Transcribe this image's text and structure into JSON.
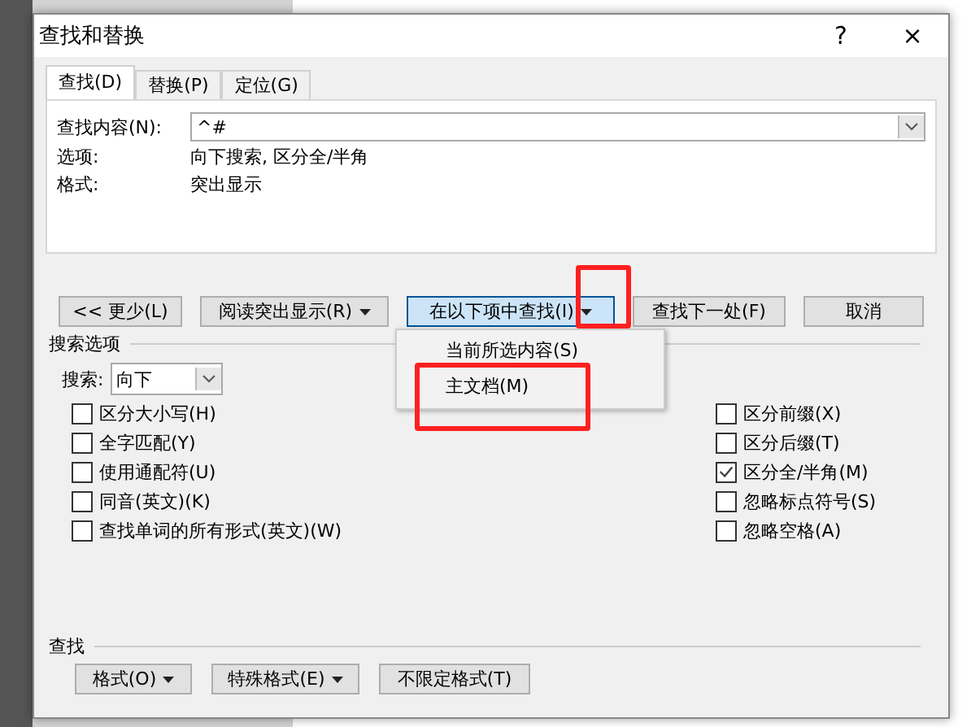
{
  "window": {
    "title": "查找和替换",
    "help": "?",
    "close": "×"
  },
  "tabs": [
    {
      "label": "查找(D)",
      "selected": true
    },
    {
      "label": "替换(P)",
      "selected": false
    },
    {
      "label": "定位(G)",
      "selected": false
    }
  ],
  "find": {
    "label": "查找内容(N):",
    "value": "^#"
  },
  "info": [
    {
      "label": "选项:",
      "value": "向下搜索, 区分全/半角"
    },
    {
      "label": "格式:",
      "value": "突出显示"
    }
  ],
  "buttons": [
    {
      "label": "<< 更少(L)",
      "dropdown": false,
      "pressed": false
    },
    {
      "label": "阅读突出显示(R)",
      "dropdown": true,
      "pressed": false
    },
    {
      "label": "在以下项中查找(I)",
      "dropdown": true,
      "pressed": true
    },
    {
      "label": "查找下一处(F)",
      "dropdown": false,
      "pressed": false
    },
    {
      "label": "取消",
      "dropdown": false,
      "pressed": false
    }
  ],
  "menu": {
    "items": [
      {
        "label": "当前所选内容(S)"
      },
      {
        "label": "主文档(M)"
      }
    ]
  },
  "search_options": {
    "title": "搜索选项",
    "direction_label": "搜索:",
    "direction": "向下",
    "left": [
      {
        "label": "区分大小写(H)",
        "checked": false
      },
      {
        "label": "全字匹配(Y)",
        "checked": false
      },
      {
        "label": "使用通配符(U)",
        "checked": false
      },
      {
        "label": "同音(英文)(K)",
        "checked": false
      },
      {
        "label": "查找单词的所有形式(英文)(W)",
        "checked": false
      }
    ],
    "right": [
      {
        "label": "区分前缀(X)",
        "checked": false
      },
      {
        "label": "区分后缀(T)",
        "checked": false
      },
      {
        "label": "区分全/半角(M)",
        "checked": true
      },
      {
        "label": "忽略标点符号(S)",
        "checked": false
      },
      {
        "label": "忽略空格(A)",
        "checked": false
      }
    ]
  },
  "find_section": {
    "title": "查找",
    "buttons": [
      {
        "label": "格式(O)",
        "dropdown": true
      },
      {
        "label": "特殊格式(E)",
        "dropdown": true
      },
      {
        "label": "不限定格式(T)",
        "dropdown": false
      }
    ]
  }
}
